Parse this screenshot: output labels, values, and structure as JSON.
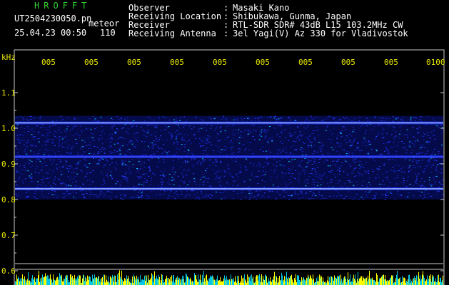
{
  "header": {
    "app_name": "HROFFT",
    "filename": "UT2504230050.pn",
    "mode": "meteor",
    "datetime": "25.04.23 00:50",
    "count": "110",
    "fields": [
      {
        "label": "Observer",
        "value": "Masaki Kano"
      },
      {
        "label": "Receiving Location",
        "value": "Shibukawa, Gunma, Japan"
      },
      {
        "label": "Receiver",
        "value": "RTL-SDR SDR# 43dB L15 103.2MHz CW"
      },
      {
        "label": "Receiving Antenna",
        "value": "3el Yagi(V) Az 330 for Vladivostok"
      }
    ]
  },
  "chart_data": {
    "type": "heatmap",
    "ylabel": "kHz",
    "y_ticks": [
      "1.1",
      "1.0",
      "0.9",
      "0.8",
      "0.7",
      "0.6"
    ],
    "y_tick_values": [
      1.1,
      1.0,
      0.9,
      0.8,
      0.7,
      0.6
    ],
    "ylim": [
      0.58,
      1.18
    ],
    "x_tick_labels": [
      "005",
      "005",
      "005",
      "005",
      "005",
      "005",
      "005",
      "005",
      "005",
      "0100"
    ],
    "horizontal_bands_khz": [
      1.015,
      0.92,
      0.83
    ],
    "colors": {
      "band": "#a8c4ff",
      "noise": "#1a2cff",
      "axis": "#c8c8c8",
      "tick_text": "#e8e800",
      "bar_yellow": "#ffff00",
      "bar_cyan": "#00c8e6"
    }
  }
}
